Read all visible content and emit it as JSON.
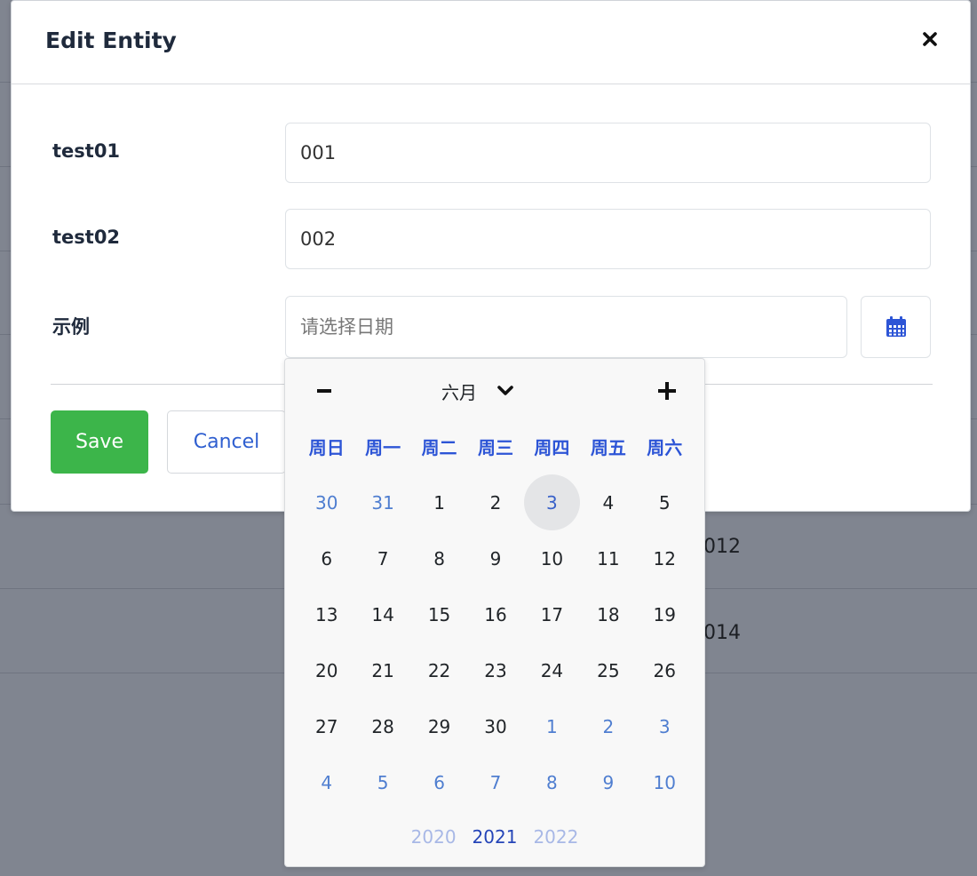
{
  "background_table": {
    "cells": [
      "012",
      "014"
    ]
  },
  "modal": {
    "title": "Edit Entity",
    "close_icon": "close-icon",
    "fields": [
      {
        "label": "test01",
        "value": "001"
      },
      {
        "label": "test02",
        "value": "002"
      }
    ],
    "date_field": {
      "label": "示例",
      "placeholder": "请选择日期",
      "button_icon": "calendar-icon"
    },
    "save_label": "Save",
    "cancel_label": "Cancel"
  },
  "datepicker": {
    "prev_icon": "minus-icon",
    "next_icon": "plus-icon",
    "month": "六月",
    "month_dropdown_icon": "chevron-down-icon",
    "weekdays": [
      "周日",
      "周一",
      "周二",
      "周三",
      "周四",
      "周五",
      "周六"
    ],
    "days": [
      {
        "label": "30",
        "state": "other"
      },
      {
        "label": "31",
        "state": "other"
      },
      {
        "label": "1",
        "state": "current"
      },
      {
        "label": "2",
        "state": "current"
      },
      {
        "label": "3",
        "state": "today"
      },
      {
        "label": "4",
        "state": "current"
      },
      {
        "label": "5",
        "state": "current"
      },
      {
        "label": "6",
        "state": "current"
      },
      {
        "label": "7",
        "state": "current"
      },
      {
        "label": "8",
        "state": "current"
      },
      {
        "label": "9",
        "state": "current"
      },
      {
        "label": "10",
        "state": "current"
      },
      {
        "label": "11",
        "state": "current"
      },
      {
        "label": "12",
        "state": "current"
      },
      {
        "label": "13",
        "state": "current"
      },
      {
        "label": "14",
        "state": "current"
      },
      {
        "label": "15",
        "state": "current"
      },
      {
        "label": "16",
        "state": "current"
      },
      {
        "label": "17",
        "state": "current"
      },
      {
        "label": "18",
        "state": "current"
      },
      {
        "label": "19",
        "state": "current"
      },
      {
        "label": "20",
        "state": "current"
      },
      {
        "label": "21",
        "state": "current"
      },
      {
        "label": "22",
        "state": "current"
      },
      {
        "label": "23",
        "state": "current"
      },
      {
        "label": "24",
        "state": "current"
      },
      {
        "label": "25",
        "state": "current"
      },
      {
        "label": "26",
        "state": "current"
      },
      {
        "label": "27",
        "state": "current"
      },
      {
        "label": "28",
        "state": "current"
      },
      {
        "label": "29",
        "state": "current"
      },
      {
        "label": "30",
        "state": "current"
      },
      {
        "label": "1",
        "state": "other"
      },
      {
        "label": "2",
        "state": "other"
      },
      {
        "label": "3",
        "state": "other"
      },
      {
        "label": "4",
        "state": "other"
      },
      {
        "label": "5",
        "state": "other"
      },
      {
        "label": "6",
        "state": "other"
      },
      {
        "label": "7",
        "state": "other"
      },
      {
        "label": "8",
        "state": "other"
      },
      {
        "label": "9",
        "state": "other"
      },
      {
        "label": "10",
        "state": "other"
      }
    ],
    "years": [
      {
        "label": "2020",
        "current": false
      },
      {
        "label": "2021",
        "current": true
      },
      {
        "label": "2022",
        "current": false
      }
    ]
  },
  "colors": {
    "accent_blue": "#2d55d6",
    "save_green": "#3cb54a",
    "overlay": "#808590",
    "today_bg": "#e4e5e7"
  }
}
